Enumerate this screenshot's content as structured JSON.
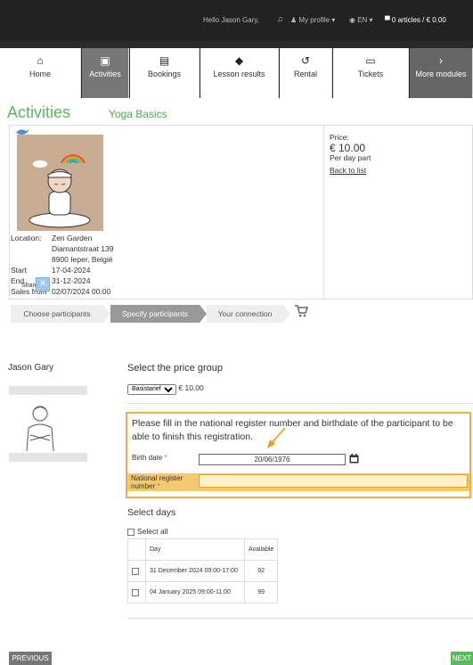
{
  "topbar": {
    "hello": "Hello Jason Gary,",
    "profile": "My profile ▾",
    "language": "EN ▾",
    "cart": "0 articles / € 0.00"
  },
  "nav": {
    "tabs": [
      {
        "label": "Home",
        "icon": "home-icon",
        "glyph": "⌂"
      },
      {
        "label": "Activities",
        "icon": "calendar-icon",
        "glyph": "▣"
      },
      {
        "label": "Bookings",
        "icon": "clipboard-icon",
        "glyph": "▤"
      },
      {
        "label": "Lesson results",
        "icon": "graduation-cap-icon",
        "glyph": "◆"
      },
      {
        "label": "Rental",
        "icon": "history-icon",
        "glyph": "↺"
      },
      {
        "label": "Tickets",
        "icon": "ticket-icon",
        "glyph": "▭"
      },
      {
        "label": "More modules",
        "icon": "chevron-right-icon",
        "glyph": "›"
      }
    ]
  },
  "page": {
    "title": "Activities"
  },
  "activity": {
    "title": "Yoga Basics",
    "location_label": "Location:",
    "location_lines": [
      "Zen Garden",
      "Diamantstraat 139",
      "8900 Ieper, België"
    ],
    "start_label": "Start",
    "start": "17-04-2024",
    "end_label": "End",
    "end": "31-12-2024",
    "sales_label": "Sales from",
    "sales": "02/07/2024 00:00",
    "share_label": "Share:",
    "price_label": "Price:",
    "price": "€ 10.00",
    "per_day": "Per day part",
    "back": "Back to list"
  },
  "steps": [
    "Choose participants",
    "Specify participants",
    "Your connection"
  ],
  "participant": {
    "name": "Jason Gary"
  },
  "price_group": {
    "title": "Select the price group",
    "selected": "Basistarief",
    "price": "€ 10.00"
  },
  "notice": {
    "text": "Please fill in the national register number and birthdate of the participant to be able to finish this registration.",
    "birth_label": "Birth date",
    "birth_value": "20/06/1976",
    "nr_label": "National register number",
    "required": "*"
  },
  "days": {
    "title": "Select days",
    "select_all": "Select all",
    "col_day": "Day",
    "col_available": "Available",
    "rows": [
      {
        "day": "31 December 2024 09:00-17:00",
        "available": "92"
      },
      {
        "day": "04 January 2025 09:00-11:00",
        "available": "99"
      }
    ]
  },
  "buttons": {
    "previous": "PREVIOUS",
    "next": "NEXT"
  },
  "colors": {
    "accent_green": "#5cb85c",
    "warning_orange": "#f0ad4e",
    "topbar": "#222222"
  }
}
